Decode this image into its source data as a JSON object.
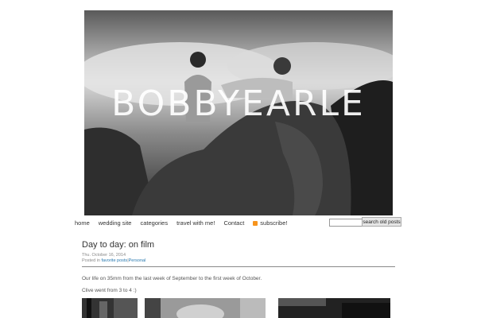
{
  "site": {
    "title": "BOBBYEARLE"
  },
  "nav": {
    "items": [
      {
        "label": "home"
      },
      {
        "label": "wedding site"
      },
      {
        "label": "categories"
      },
      {
        "label": "travel with me!"
      },
      {
        "label": "Contact"
      },
      {
        "label": "subscribe!",
        "icon": "rss-icon"
      }
    ]
  },
  "search": {
    "value": "",
    "button_label": "search old posts"
  },
  "post": {
    "title": "Day to day: on film",
    "date": "Thu. October 16, 2014",
    "posted_in_label": "Posted in",
    "categories": "favorite posts",
    "separator": "|",
    "category_2": "Personal",
    "paragraphs": [
      "Our life on 35mm from the last week of September to the first week of October.",
      "Clive went from 3 to 4 :)"
    ]
  },
  "colors": {
    "link": "#2a7ab0",
    "rss": "#f7941d"
  }
}
